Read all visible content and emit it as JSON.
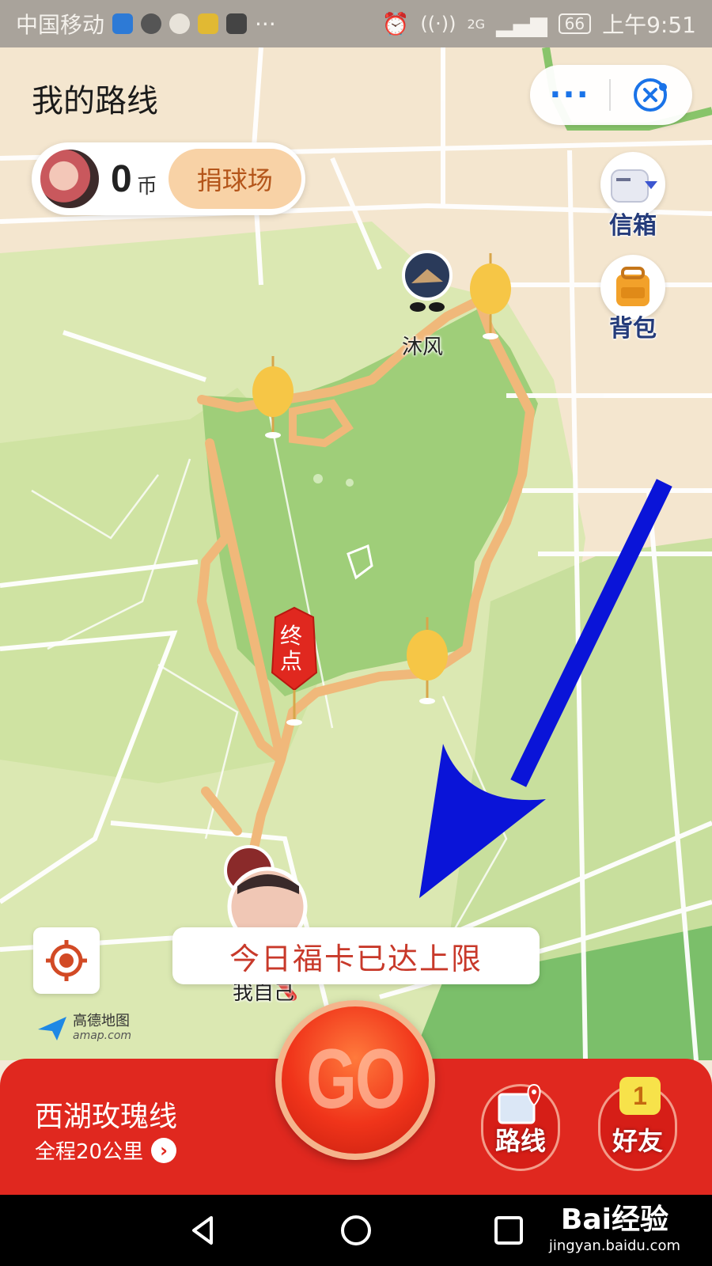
{
  "status_bar": {
    "carrier": "中国移动",
    "signal_label": "2G",
    "battery": "66",
    "time": "上午9:51",
    "more": "···"
  },
  "header": {
    "title": "我的路线",
    "more_label": "···"
  },
  "wallet": {
    "coins": "0",
    "coin_unit": "币",
    "donate_label": "捐球场"
  },
  "side_buttons": {
    "mailbox_label": "信箱",
    "backpack_label": "背包"
  },
  "map": {
    "friend_name": "沐风",
    "self_name": "我自己",
    "end_marker": "终点",
    "toast": "今日福卡已达上限",
    "logo_cn": "高德地图",
    "logo_en": "amap.com"
  },
  "bottom_bar": {
    "route_name": "西湖玫瑰线",
    "route_distance": "全程20公里",
    "go_label": "GO",
    "routes_label": "路线",
    "friends_label": "好友",
    "friends_badge": "1"
  },
  "watermark": {
    "brand": "Bai经验",
    "url": "jingyan.baidu.com"
  },
  "colors": {
    "accent_red": "#e0281f",
    "route_orange": "#f0b87a",
    "arrow_blue": "#0a14d8",
    "park_green": "#9fce79"
  }
}
